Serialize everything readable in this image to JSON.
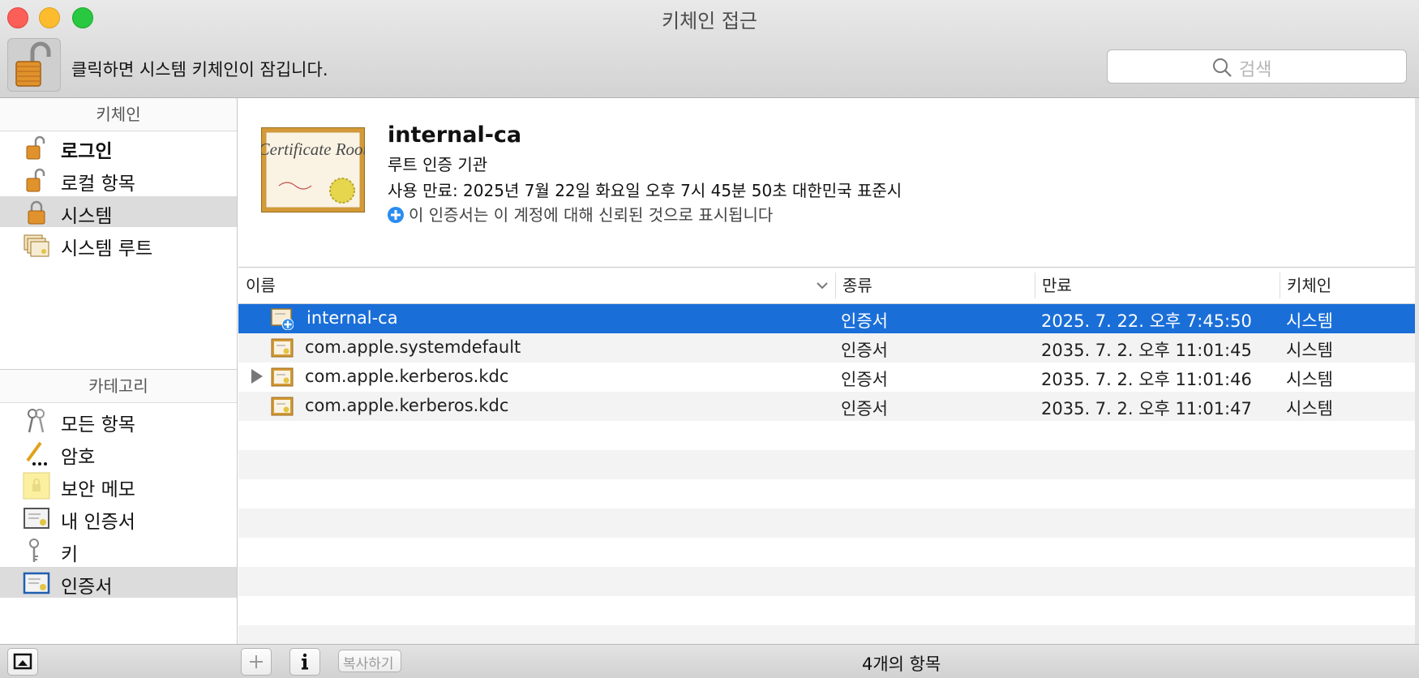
{
  "window": {
    "title": "키체인 접근"
  },
  "toolbar": {
    "lock_text": "클릭하면 시스템 키체인이 잠깁니다.",
    "search_placeholder": "검색"
  },
  "sidebar": {
    "keychains_header": "키체인",
    "keychains": [
      {
        "label": "로그인",
        "icon": "lock-open-icon",
        "bold": true
      },
      {
        "label": "로컬 항목",
        "icon": "lock-open-icon"
      },
      {
        "label": "시스템",
        "icon": "lock-closed-icon",
        "selected": true
      },
      {
        "label": "시스템 루트",
        "icon": "certificate-stack-icon"
      }
    ],
    "categories_header": "카테고리",
    "categories": [
      {
        "label": "모든 항목",
        "icon": "keys-icon"
      },
      {
        "label": "암호",
        "icon": "pencil-password-icon"
      },
      {
        "label": "보안 메모",
        "icon": "note-lock-icon"
      },
      {
        "label": "내 인증서",
        "icon": "my-certificate-icon"
      },
      {
        "label": "키",
        "icon": "key-icon"
      },
      {
        "label": "인증서",
        "icon": "certificate-icon",
        "selected": true
      }
    ]
  },
  "detail": {
    "name": "internal-ca",
    "kind": "루트 인증 기관",
    "expires": "사용 만료: 2025년 7월 22일 화요일 오후 7시 45분 50초 대한민국 표준시",
    "trust": "이 인증서는 이 계정에 대해 신뢰된 것으로 표시됩니다",
    "cert_image_text": "Certificate Root"
  },
  "table": {
    "columns": [
      "이름",
      "종류",
      "만료",
      "키체인"
    ],
    "rows": [
      {
        "name": "internal-ca",
        "kind": "인증서",
        "expires": "2025. 7. 22. 오후 7:45:50",
        "keychain": "시스템",
        "selected": true,
        "trusted_badge": true
      },
      {
        "name": "com.apple.systemdefault",
        "kind": "인증서",
        "expires": "2035. 7. 2. 오후 11:01:45",
        "keychain": "시스템"
      },
      {
        "name": "com.apple.kerberos.kdc",
        "kind": "인증서",
        "expires": "2035. 7. 2. 오후 11:01:46",
        "keychain": "시스템",
        "expandable": true
      },
      {
        "name": "com.apple.kerberos.kdc",
        "kind": "인증서",
        "expires": "2035. 7. 2. 오후 11:01:47",
        "keychain": "시스템"
      }
    ]
  },
  "bottombar": {
    "add_label": "+",
    "info_label": "i",
    "copy_label": "복사하기",
    "item_count": "4개의 항목"
  },
  "colors": {
    "selection": "#1a6ed8",
    "sidebar_selection": "#dcdcdc",
    "trust_badge": "#2a8cf0"
  }
}
